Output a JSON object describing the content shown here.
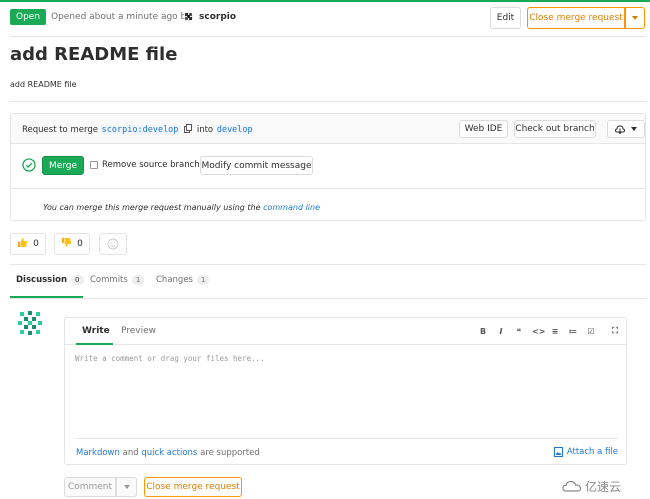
{
  "header": {
    "status_badge": "Open",
    "opened_text": "Opened about a minute ago by",
    "author": "scorpio",
    "edit_label": "Edit",
    "close_label": "Close merge request"
  },
  "title": "add README file",
  "description": "add README file",
  "merge_widget": {
    "request_to_merge": "Request to merge",
    "source_branch": "scorpio:develop",
    "into_label": "into",
    "target_branch": "develop",
    "web_ide_label": "Web IDE",
    "checkout_label": "Check out branch",
    "merge_label": "Merge",
    "remove_source_label": "Remove source branch",
    "modify_commit_label": "Modify commit message",
    "manual_text": "You can merge this merge request manually using the",
    "command_line_link": "command line"
  },
  "awards": {
    "thumbsup_count": "0",
    "thumbsdown_count": "0"
  },
  "tabs": [
    {
      "label": "Discussion",
      "count": "0"
    },
    {
      "label": "Commits",
      "count": "1"
    },
    {
      "label": "Changes",
      "count": "1"
    }
  ],
  "editor": {
    "write_tab": "Write",
    "preview_tab": "Preview",
    "placeholder": "Write a comment or drag your files here...",
    "markdown_link": "Markdown",
    "and_text": "and",
    "quick_actions_link": "quick actions",
    "supported_text": "are supported",
    "attach_label": "Attach a file",
    "toolbar": [
      "B",
      "I",
      "❝",
      "<>",
      "≡",
      "≔",
      "☑",
      "⛶"
    ]
  },
  "actions": {
    "comment_label": "Comment",
    "close_label": "Close merge request"
  },
  "watermark": "亿速云",
  "colors": {
    "accent_green": "#1aaa55",
    "warning_orange": "#fc9403",
    "link_blue": "#1f78d1"
  }
}
